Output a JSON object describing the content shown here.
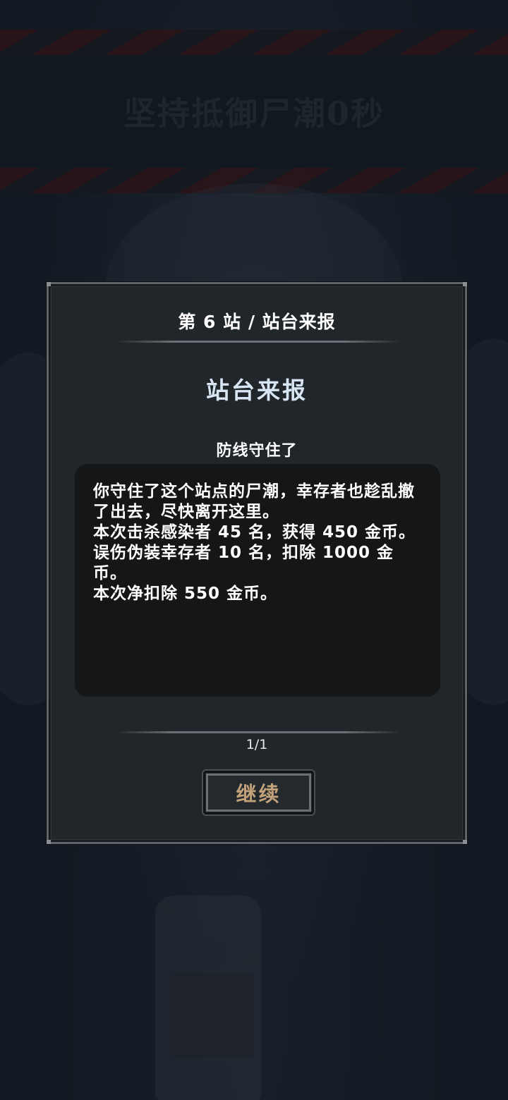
{
  "background": {
    "banner_title": "坚持抵御尸潮0秒"
  },
  "dialog": {
    "breadcrumb": "第 6 站 / 站台来报",
    "title": "站台来报",
    "subtitle": "防线守住了",
    "message_lines": [
      "你守住了这个站点的尸潮，幸存者也趁乱撤了出去，尽快离开这里。",
      "本次击杀感染者 45 名，获得 450 金币。",
      "误伤伪装幸存者 10 名，扣除 1000 金币。",
      "本次净扣除 550 金币。"
    ],
    "pager": "1/1",
    "continue_label": "继续"
  },
  "colors": {
    "title_blue": "#d8e6f4",
    "button_text_gold": "#c2a27a",
    "panel": "#21262b",
    "message_box": "#141617"
  }
}
